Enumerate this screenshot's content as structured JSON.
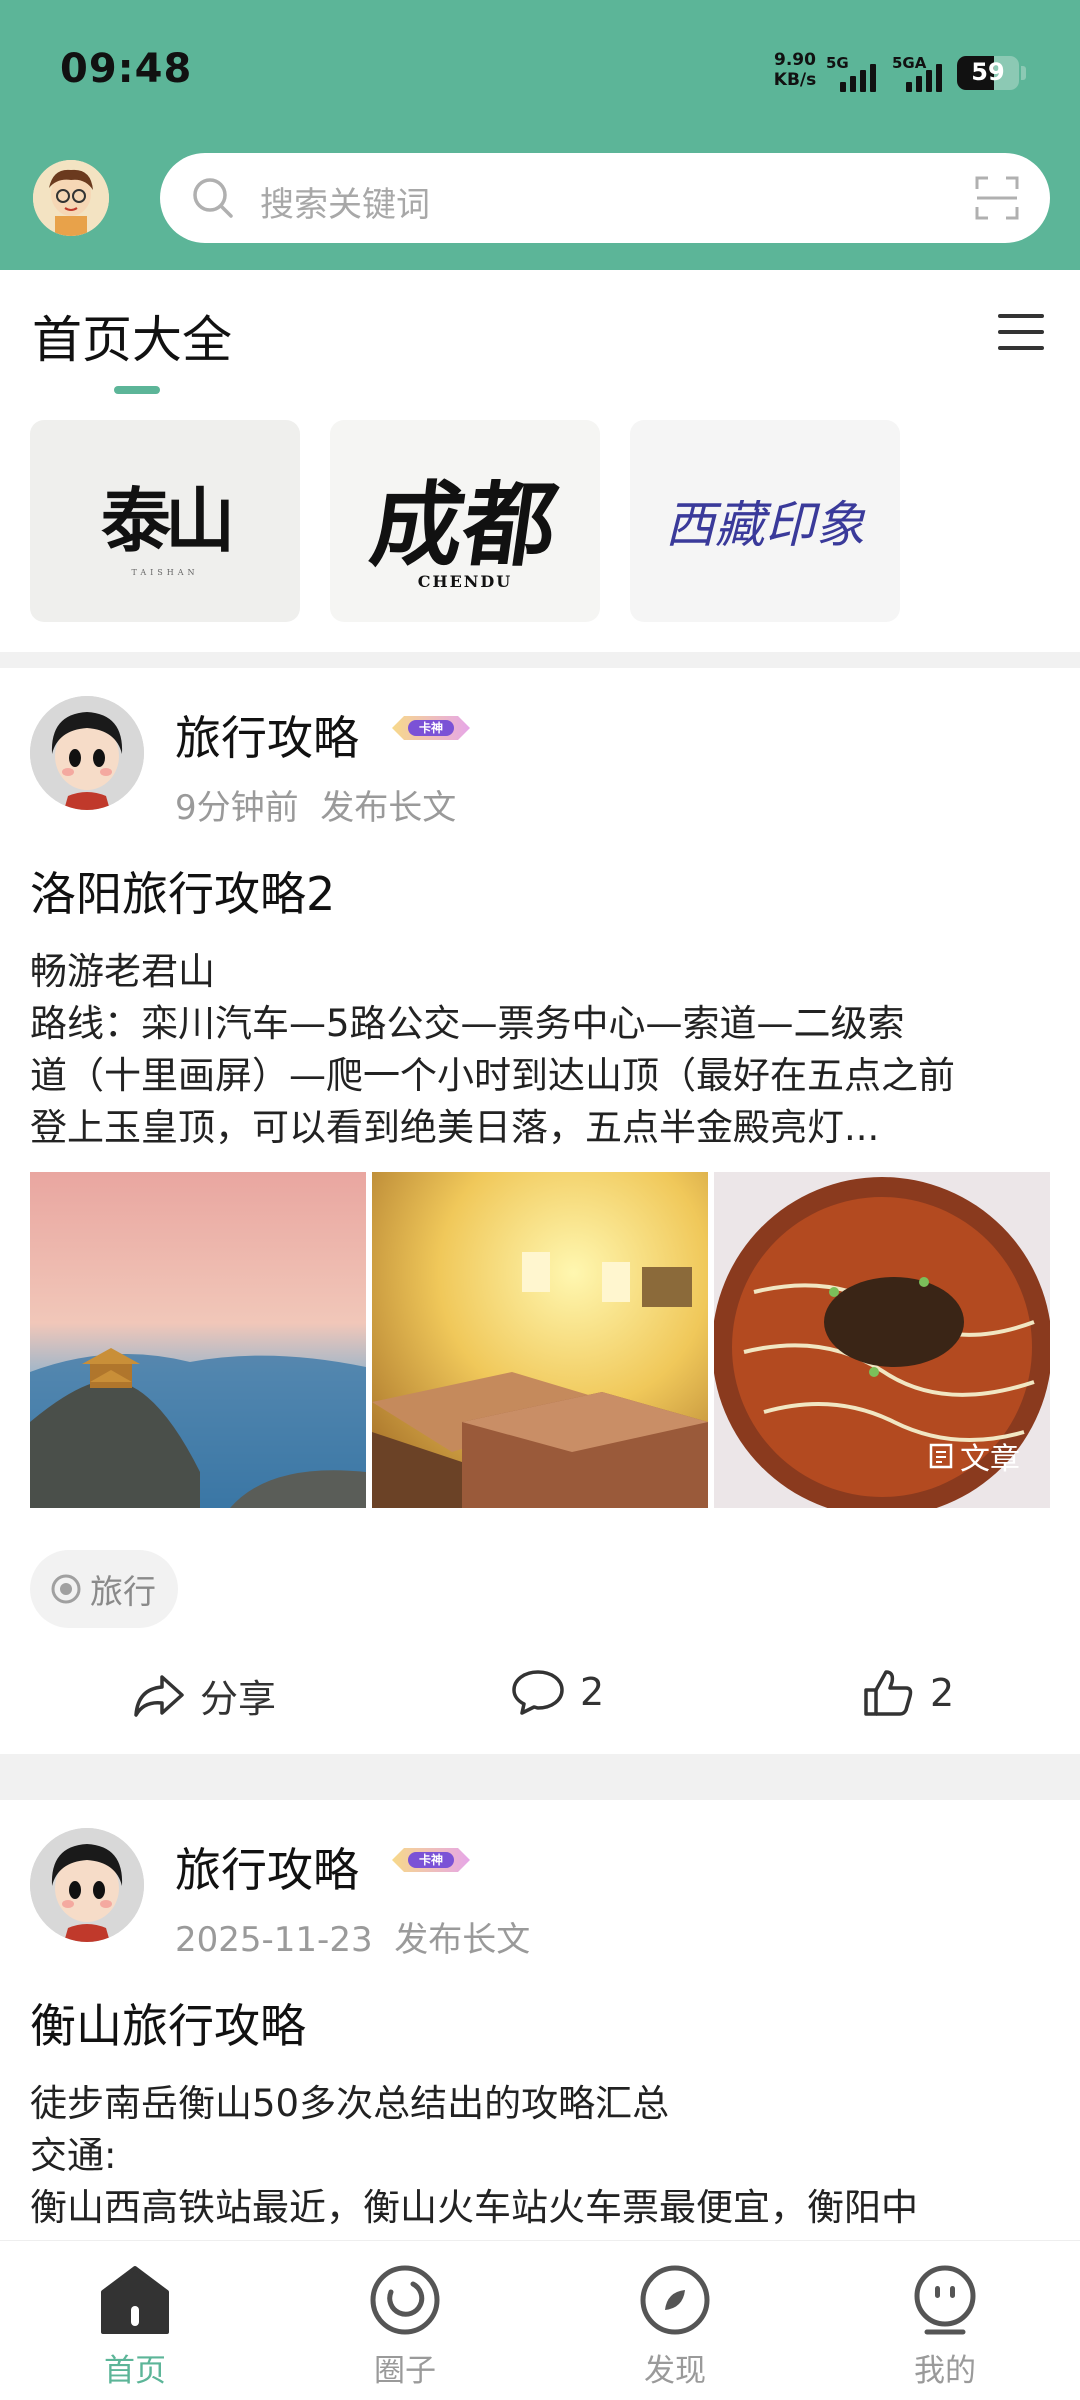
{
  "status_bar": {
    "time": "09:48",
    "net_speed_value": "9.90",
    "net_speed_unit": "KB/s",
    "sim1": "5G",
    "sim2": "5GA",
    "battery": "59"
  },
  "search": {
    "placeholder": "搜索关键词"
  },
  "section": {
    "title": "首页大全"
  },
  "cards": [
    {
      "text": "泰山",
      "sub": "TAISHAN"
    },
    {
      "text": "成都",
      "sub": "CHENDU"
    },
    {
      "text": "西藏印象",
      "sub": ""
    }
  ],
  "posts": [
    {
      "author": "旅行攻略",
      "badge": "卡神",
      "time": "9分钟前",
      "action": "发布长文",
      "title": "洛阳旅行攻略2",
      "body": [
        "畅游老君山",
        "路线：栾川汽车—5路公交—票务中心—索道—二级索",
        "道（十里画屏）—爬一个小时到达山顶（最好在五点之前",
        "登上玉皇顶，可以看到绝美日落，五点半金殿亮灯..."
      ],
      "image_badge": "文章",
      "tag": "旅行",
      "share_label": "分享",
      "comments": "2",
      "likes": "2"
    },
    {
      "author": "旅行攻略",
      "badge": "卡神",
      "time": "2025-11-23",
      "action": "发布长文",
      "title": "衡山旅行攻略",
      "body": [
        "徒步南岳衡山50多次总结出的攻略汇总",
        "交通:",
        "衡山西高铁站最近，衡山火车站火车票最便宜，衡阳中"
      ]
    }
  ],
  "nav": [
    {
      "label": "首页",
      "icon": "home-icon",
      "active": true
    },
    {
      "label": "圈子",
      "icon": "circle-icon",
      "active": false
    },
    {
      "label": "发现",
      "icon": "discover-icon",
      "active": false
    },
    {
      "label": "我的",
      "icon": "profile-icon",
      "active": false
    }
  ],
  "colors": {
    "brand": "#5cb598",
    "muted": "#9a9a9a"
  }
}
